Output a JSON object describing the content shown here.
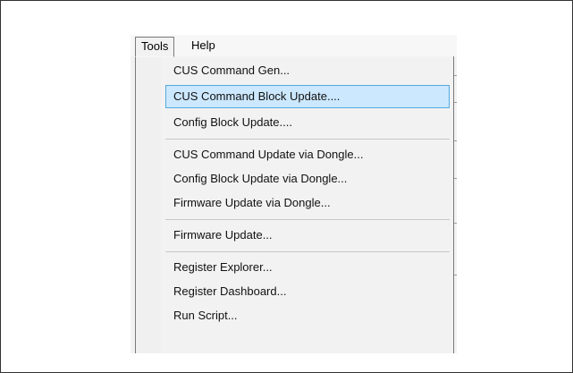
{
  "menubar": {
    "tools_label": "Tools",
    "help_label": "Help"
  },
  "tools_menu": {
    "items": [
      {
        "label": "CUS Command Gen..."
      },
      {
        "label": "CUS Command Block Update...."
      },
      {
        "label": "Config Block Update...."
      },
      {
        "label": "CUS Command Update via Dongle..."
      },
      {
        "label": "Config Block Update via Dongle..."
      },
      {
        "label": "Firmware Update via Dongle..."
      },
      {
        "label": "Firmware Update..."
      },
      {
        "label": "Register Explorer..."
      },
      {
        "label": "Register Dashboard..."
      },
      {
        "label": "Run Script..."
      }
    ],
    "highlighted_item": "CUS Command Block Update....",
    "colors": {
      "highlight_fill": "#cce8ff",
      "highlight_border": "#56a8de"
    }
  }
}
